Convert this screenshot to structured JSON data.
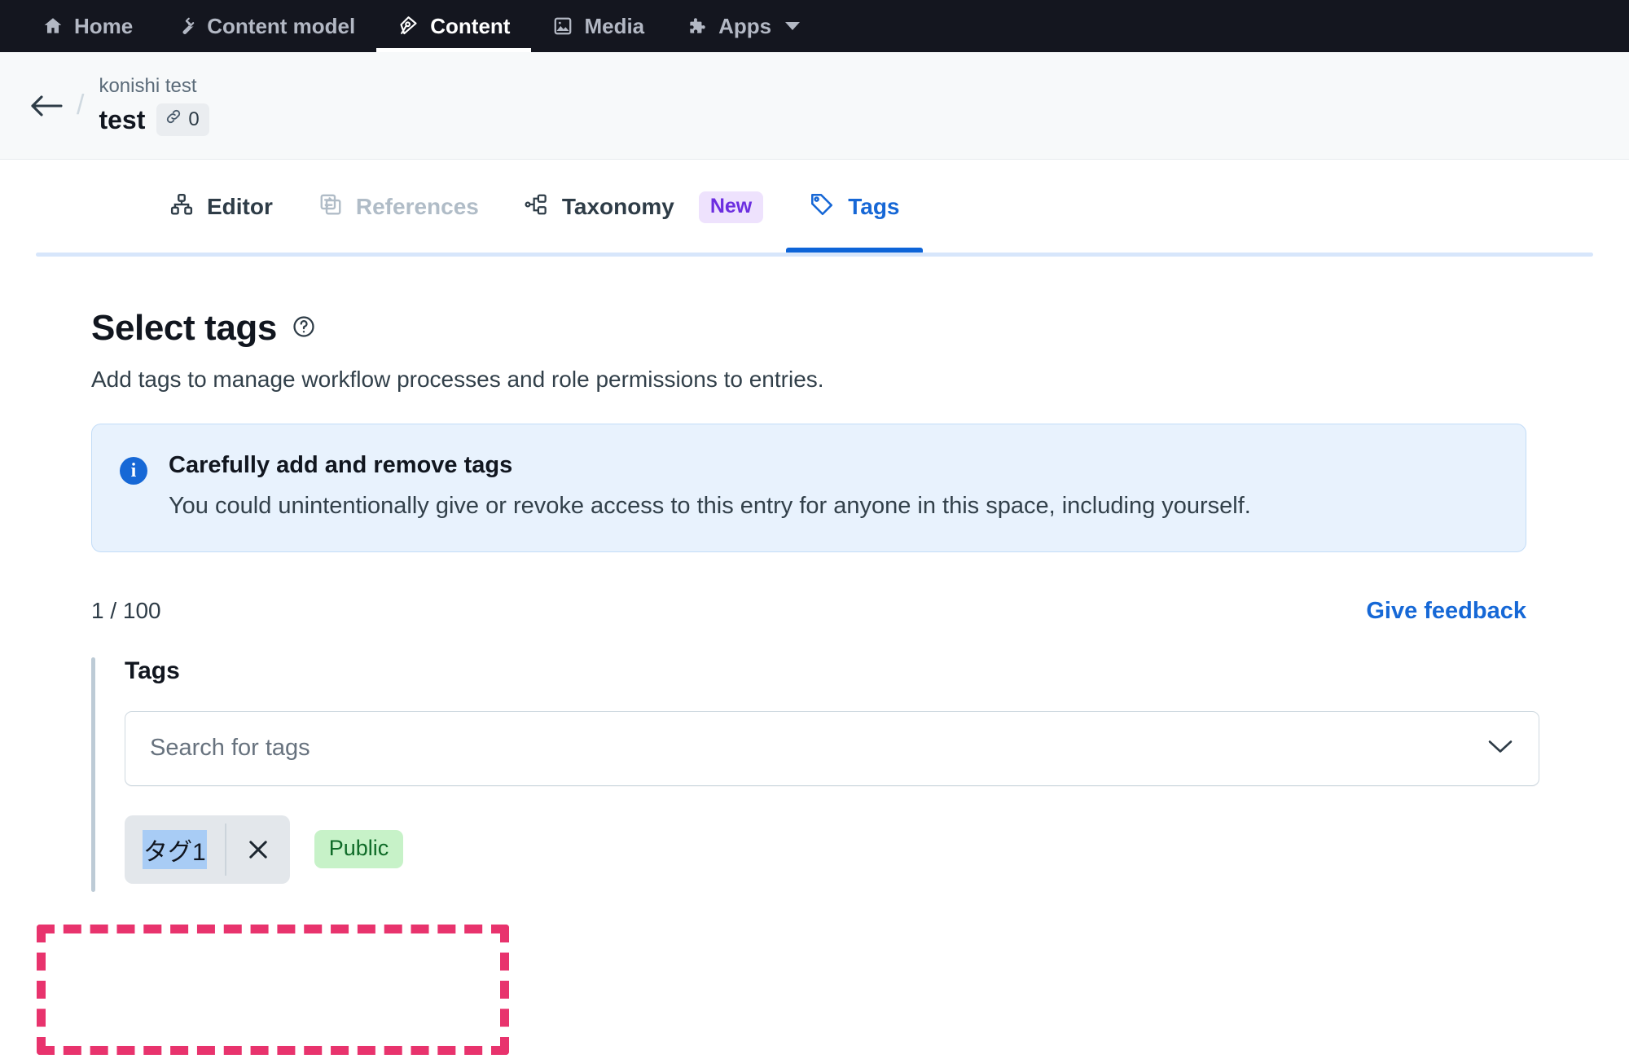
{
  "topnav": {
    "items": [
      {
        "label": "Home",
        "icon": "home-icon",
        "active": false
      },
      {
        "label": "Content model",
        "icon": "wrench-icon",
        "active": false
      },
      {
        "label": "Content",
        "icon": "pen-nib-icon",
        "active": true
      },
      {
        "label": "Media",
        "icon": "image-icon",
        "active": false
      },
      {
        "label": "Apps",
        "icon": "puzzle-icon",
        "active": false,
        "caret": true
      }
    ]
  },
  "breadcrumb": {
    "back": "back-arrow",
    "separator": "/",
    "parent": "konishi test",
    "current": "test",
    "links_count": "0"
  },
  "tabs": [
    {
      "label": "Editor",
      "icon": "blocks-icon",
      "state": "default"
    },
    {
      "label": "References",
      "icon": "references-icon",
      "state": "disabled"
    },
    {
      "label": "Taxonomy",
      "icon": "taxonomy-icon",
      "state": "default",
      "badge": "New"
    },
    {
      "label": "Tags",
      "icon": "tag-icon",
      "state": "active"
    }
  ],
  "main": {
    "title": "Select tags",
    "subtitle": "Add tags to manage workflow processes and role permissions to entries.",
    "note": {
      "title": "Carefully add and remove tags",
      "text": "You could unintentionally give or revoke access to this entry for anyone in this space, including yourself."
    },
    "counter": "1 / 100",
    "feedback": "Give feedback",
    "field_label": "Tags",
    "search_placeholder": "Search for tags",
    "selected_tags": [
      {
        "name": "タグ1",
        "remove": "×",
        "visibility": "Public"
      }
    ]
  },
  "colors": {
    "nav_bg": "#14161f",
    "active_tab": "#1667d6",
    "tab_underline": "#0d64d8",
    "tab_baseline": "#d7e6fb",
    "note_bg": "#e8f2fd",
    "note_border": "#c2dcf7",
    "note_icon": "#1668d6",
    "link": "#1668d6",
    "new_badge_bg": "#eee2fd",
    "new_badge_text": "#6c2ee0",
    "pill_bg": "#e3e7eb",
    "text_selection": "#a8ccf5",
    "public_badge_bg": "#c7f2c8",
    "public_badge_text": "#0f6b28",
    "annotation": "#e8336d"
  }
}
